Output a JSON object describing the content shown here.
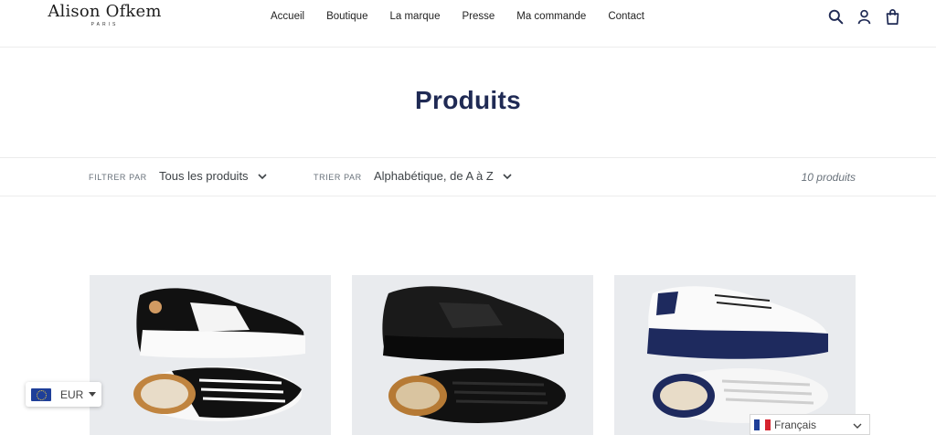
{
  "brand": {
    "name": "Alison Ofkem",
    "sub": "PARIS"
  },
  "nav": [
    {
      "label": "Accueil"
    },
    {
      "label": "Boutique"
    },
    {
      "label": "La marque"
    },
    {
      "label": "Presse"
    },
    {
      "label": "Ma commande"
    },
    {
      "label": "Contact"
    }
  ],
  "header_icons": [
    "search-icon",
    "account-icon",
    "cart-icon"
  ],
  "page": {
    "title": "Produits"
  },
  "filters": {
    "filter_label": "FILTRER PAR",
    "filter_value": "Tous les produits",
    "sort_label": "TRIER PAR",
    "sort_value": "Alphabétique, de A à Z",
    "count": "10 produits"
  },
  "products": [
    {
      "colorway": "white-black"
    },
    {
      "colorway": "black"
    },
    {
      "colorway": "white-navy"
    }
  ],
  "currency": {
    "code": "EUR",
    "flag": "eu-flag-icon"
  },
  "language": {
    "label": "Français",
    "flag": "fr-flag-icon"
  },
  "colors": {
    "title": "#1f2a54",
    "text": "#3d4246",
    "muted": "#69727b",
    "product_bg": "#e9ebee"
  }
}
